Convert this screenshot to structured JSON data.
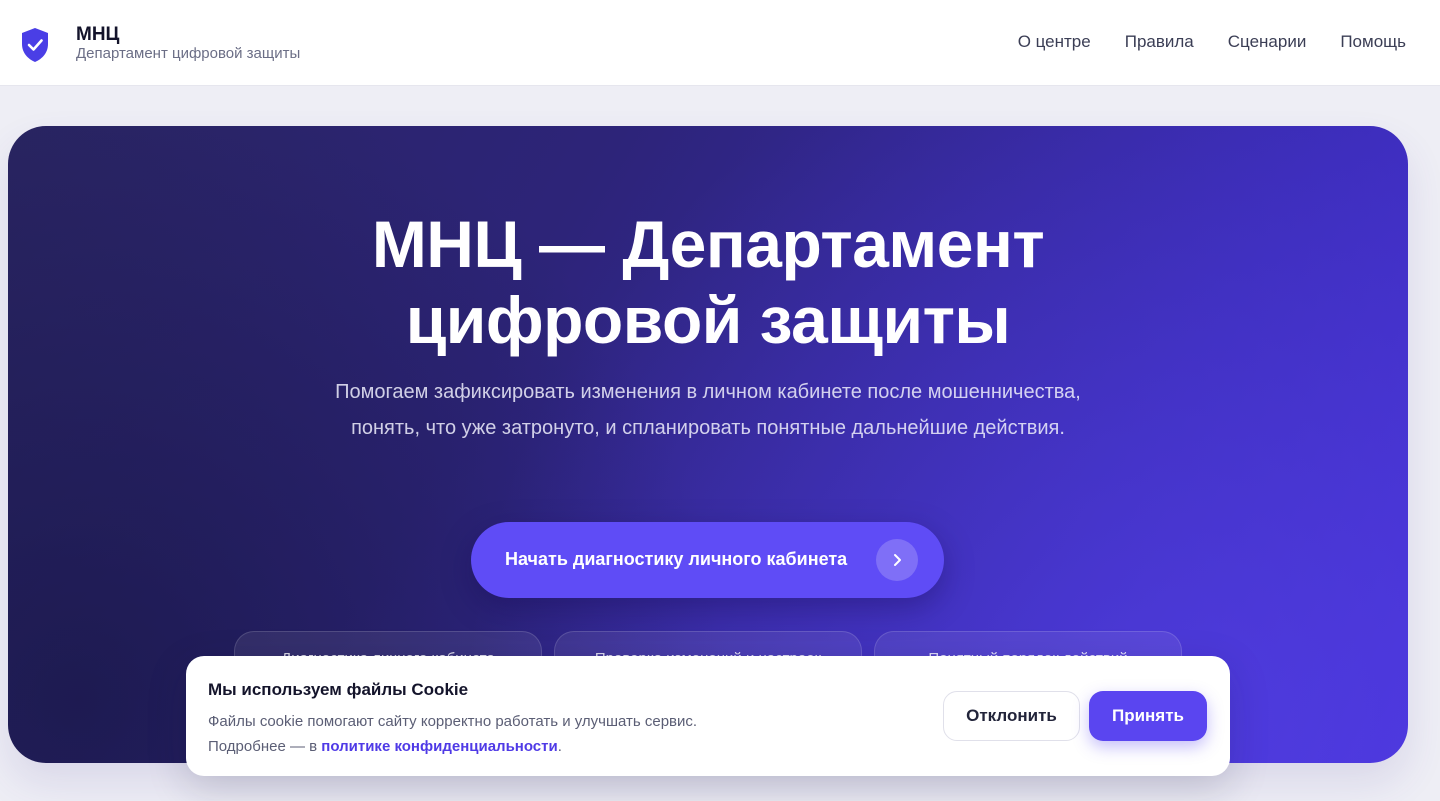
{
  "header": {
    "brand_title": "МНЦ",
    "brand_subtitle": "Департамент цифровой защиты",
    "logo_icon": "shield-check-icon",
    "nav": [
      {
        "label": "О центре"
      },
      {
        "label": "Правила"
      },
      {
        "label": "Сценарии"
      },
      {
        "label": "Помощь"
      }
    ]
  },
  "hero": {
    "title_line1": "МНЦ — Департамент",
    "title_line2": "цифровой защиты",
    "description": "Помогаем зафиксировать изменения в личном кабинете после мошенничества, понять, что уже затронуто, и спланировать понятные дальнейшие действия.",
    "cta_label": "Начать диагностику личного кабинета",
    "cta_icon": "chevron-right-icon",
    "chips": [
      {
        "label": "Диагностика личного кабинета"
      },
      {
        "label": "Проверка изменений и настроек"
      },
      {
        "label": "Понятный порядок действий"
      }
    ]
  },
  "cookie": {
    "title": "Мы используем файлы Cookie",
    "text_line1": "Файлы cookie помогают сайту корректно работать и улучшать сервис.",
    "text_line2_prefix": "Подробнее — в ",
    "policy_link": "политике конфиденциальности",
    "text_line2_suffix": ".",
    "decline_label": "Отклонить",
    "accept_label": "Принять"
  },
  "colors": {
    "accent": "#5a45f0",
    "hero_dark": "#2a2563",
    "hero_light": "#4530d4",
    "page_bg": "#eeeef5"
  }
}
